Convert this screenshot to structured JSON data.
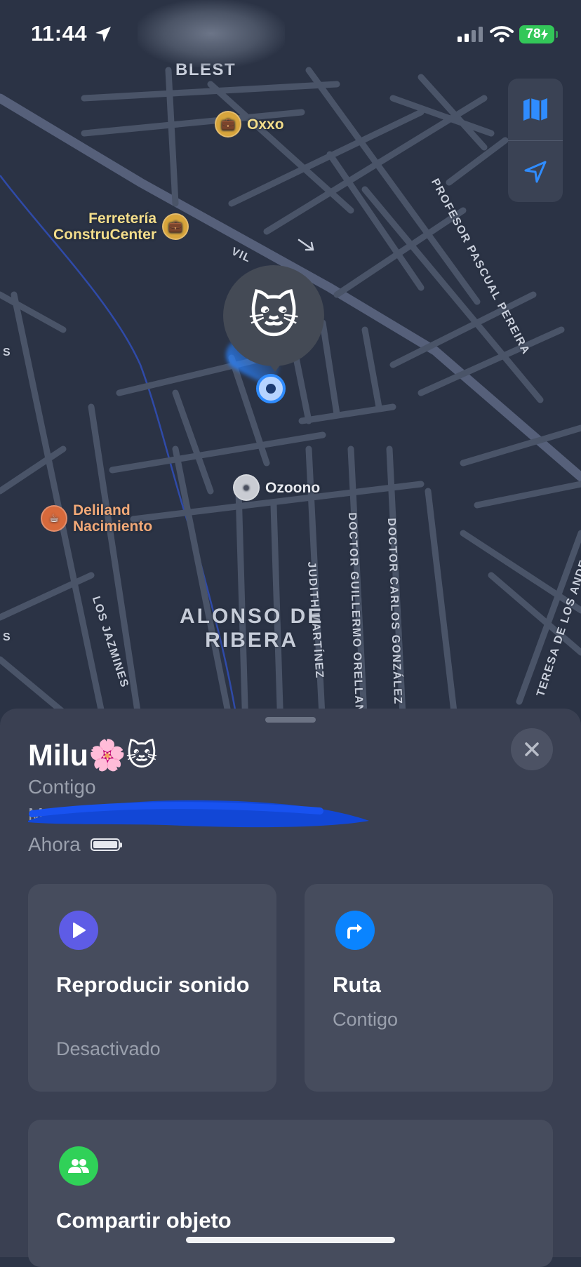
{
  "status_bar": {
    "time": "11:44",
    "battery": "78"
  },
  "map": {
    "pois": [
      {
        "name": "Oxxo",
        "kind": "shop",
        "icon": "shopping-bag-icon"
      },
      {
        "name": "Ferretería\nConstruCenter",
        "kind": "shop",
        "icon": "shopping-bag-icon"
      },
      {
        "name": "Ozoono",
        "kind": "generic",
        "icon": "dot-icon"
      },
      {
        "name": "Deliland\nNacimiento",
        "kind": "food",
        "icon": "takeout-icon"
      }
    ],
    "streets": {
      "blest": "BLEST",
      "vil": "VIL",
      "profesor_pascual_pereira": "PROFESOR PASCUAL PEREIRA",
      "judith_martinez": "JUDITH MARTÍNEZ",
      "doctor_guillermo": "DOCTOR GUILLERMO ORELLAN",
      "doctor_carlos": "DOCTOR CARLOS GONZÁLEZ",
      "los_jazmines": "LOS JAZMINES",
      "teresa_de_los_andes": "TERESA DE LOS ANDES",
      "s_left_1": "S",
      "s_left_2": "S"
    },
    "district": "ALONSO DE\nRIBERA",
    "marker_emoji": "🐱",
    "controls": [
      "map-mode-icon",
      "location-arrow-icon"
    ]
  },
  "sheet": {
    "title": "Milu🌸🐱",
    "subtitle": "Contigo",
    "redacted_text": "Ma",
    "time_label": "Ahora",
    "actions": [
      {
        "title": "Reproducir sonido",
        "subtitle": "Desactivado",
        "icon": "play-icon",
        "color": "#5e5ce6"
      },
      {
        "title": "Ruta",
        "subtitle": "Contigo",
        "icon": "directions-icon",
        "color": "#0a84ff"
      },
      {
        "title": "Compartir objeto",
        "subtitle": "",
        "icon": "people-icon",
        "color": "#30d158"
      }
    ]
  },
  "colors": {
    "map_background": "#2b3345",
    "sheet_background": "#3a4052",
    "accent_blue": "#0a84ff",
    "battery_green": "#33c759",
    "redaction_blue": "#1247d6"
  }
}
